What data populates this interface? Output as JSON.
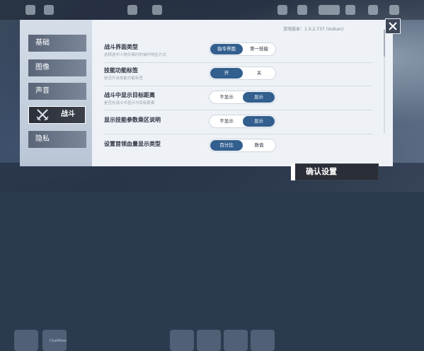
{
  "version_text": "游戏版本：1.0.2.737 (Vulkan)",
  "sidebar": {
    "faint_header": "",
    "items": [
      {
        "label": "基础"
      },
      {
        "label": "图像"
      },
      {
        "label": "声音"
      },
      {
        "label": "战斗"
      },
      {
        "label": "隐私"
      }
    ],
    "active_index": 3
  },
  "settings": [
    {
      "title": "战斗界面类型",
      "subtitle": "选择选中人物头像时的操作响应方式",
      "options": [
        "指令界面",
        "第一技能"
      ],
      "selected": 0
    },
    {
      "title": "技能功能标签",
      "subtitle": "是否开启技能功能标签",
      "options": [
        "开",
        "关"
      ],
      "selected": 0
    },
    {
      "title": "战斗中显示目标距离",
      "subtitle": "是否在战斗中显示与目标距离",
      "options": [
        "不显示",
        "显示"
      ],
      "selected": 1
    },
    {
      "title": "显示技能参数乘区说明",
      "subtitle": "",
      "options": [
        "不显示",
        "显示"
      ],
      "selected": 1
    },
    {
      "title": "设置首领血量显示类型",
      "subtitle": "",
      "options": [
        "百分比",
        "数值"
      ],
      "selected": 0
    }
  ],
  "confirm_label": "确认设置",
  "bottom_text": "ChatMore",
  "colors": {
    "selected": "#335f8f",
    "panel": "#eef2f6",
    "sidebar_active": "#2b2f38"
  },
  "icons": [
    "close-icon",
    "crossed-swords-icon"
  ]
}
